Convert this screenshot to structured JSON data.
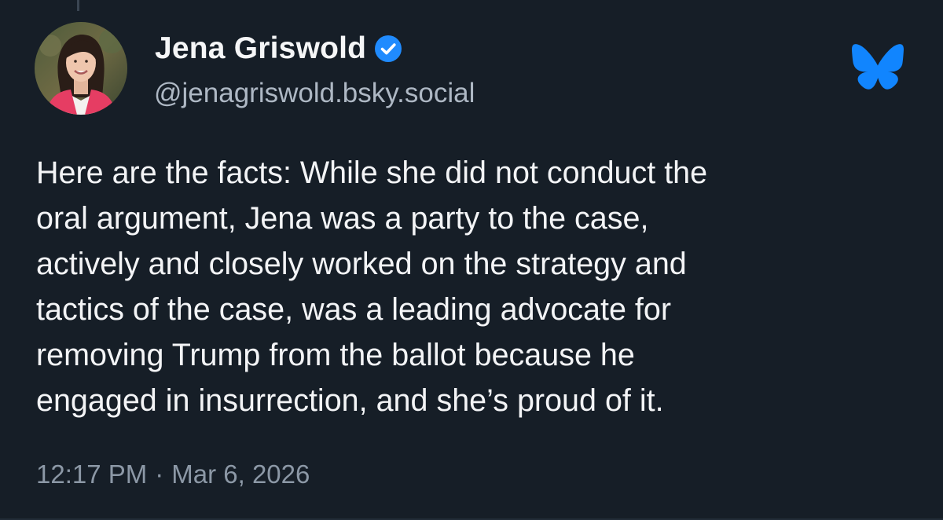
{
  "post": {
    "author": {
      "display_name": "Jena Griswold",
      "handle": "@jenagriswold.bsky.social",
      "verified": true,
      "avatar_icon": "profile-photo",
      "verified_icon": "verified-check-icon"
    },
    "app_icon": "bluesky-butterfly-icon",
    "text_lines": [
      "Here are the facts: While she did not conduct the",
      "oral argument, Jena was a party to the case,",
      "actively and closely worked on the strategy and",
      "tactics of the case, was a leading advocate for",
      "removing Trump from the ballot because he",
      "engaged in insurrection, and she’s proud of it."
    ],
    "time": "12:17 PM",
    "separator": "·",
    "date": "Mar 6, 2026"
  },
  "colors": {
    "background": "#161e27",
    "text": "#f3f4f6",
    "handle": "#aeb8c4",
    "meta": "#8c98a6",
    "bluesky_blue": "#1185fe",
    "verified_blue": "#208bfe"
  }
}
